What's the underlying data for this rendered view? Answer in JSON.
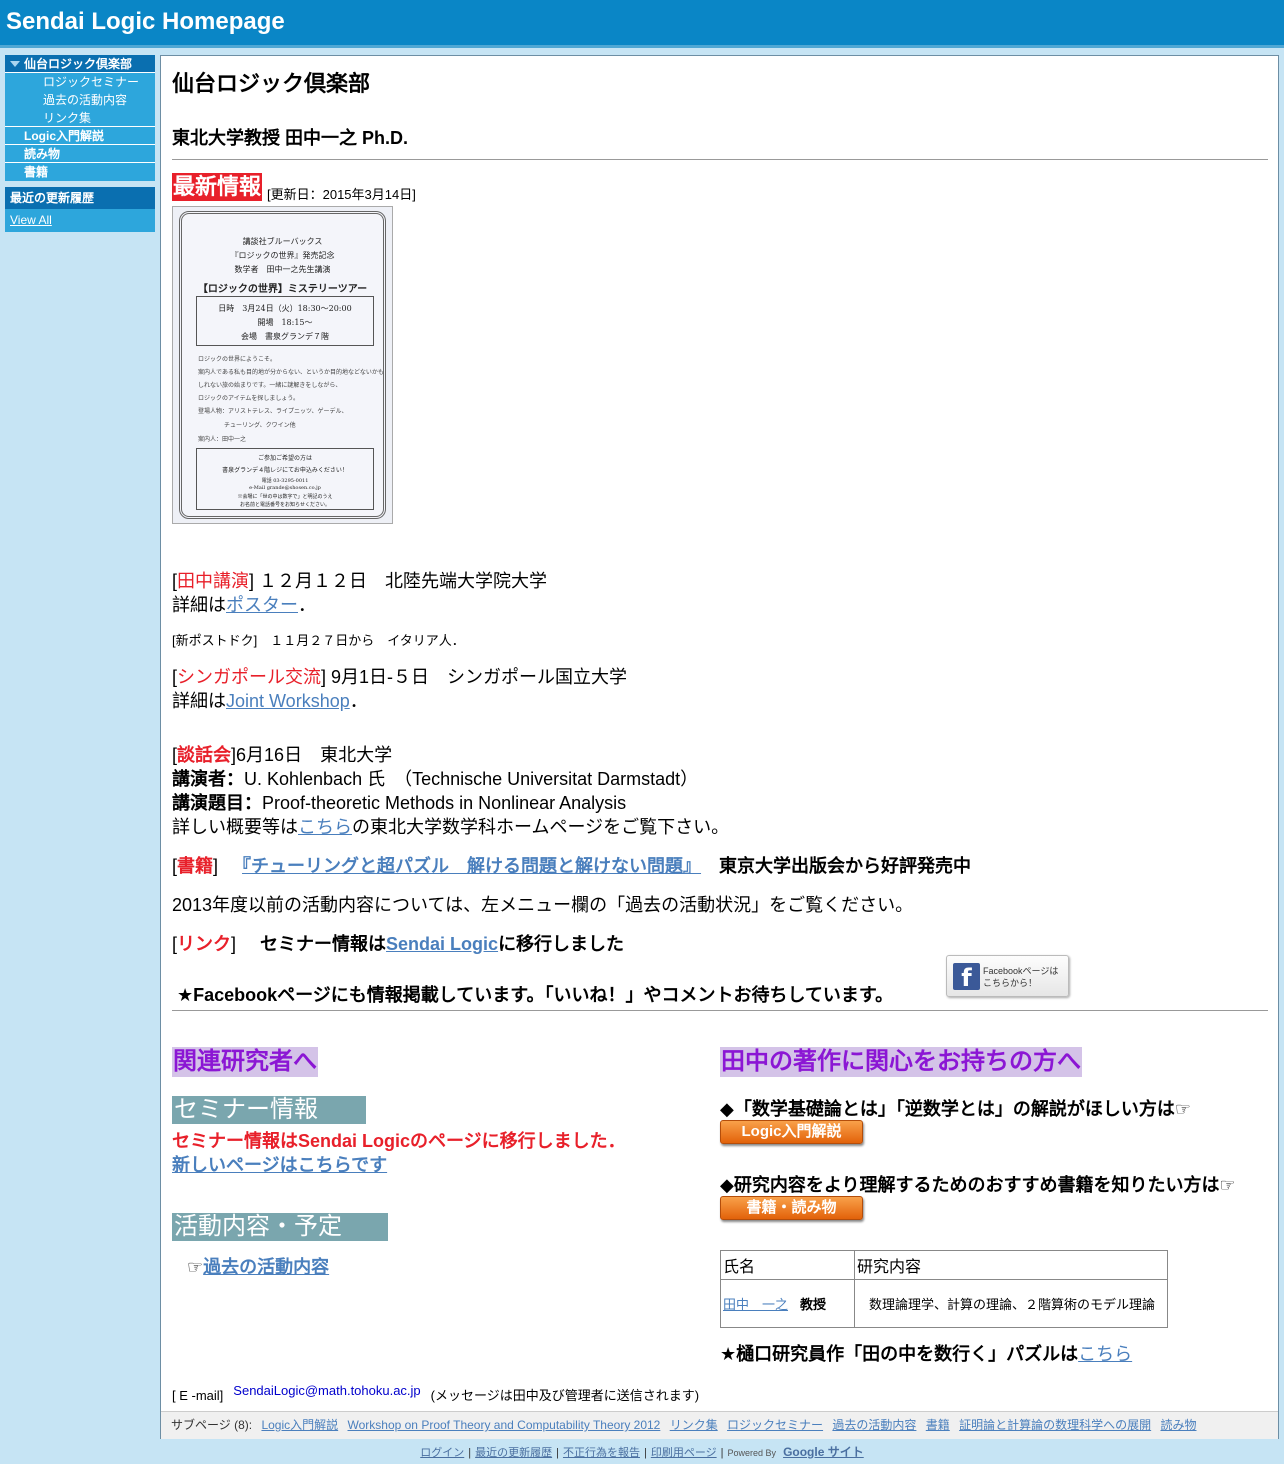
{
  "header": {
    "site_title": "Sendai Logic Homepage"
  },
  "sidebar": {
    "items": [
      {
        "label": "仙台ロジック倶楽部"
      },
      {
        "label": "ロジックセミナー"
      },
      {
        "label": "過去の活動内容"
      },
      {
        "label": "リンク集"
      },
      {
        "label": "Logic入門解説"
      },
      {
        "label": "読み物"
      },
      {
        "label": "書籍"
      }
    ],
    "recent_title": "最近の更新履歴",
    "recent_link": "View All"
  },
  "main": {
    "title": "仙台ロジック倶楽部",
    "subtitle": "東北大学教授 田中一之 Ph.D.",
    "news_title": "最新情報",
    "news_date": "[更新日：2015年3月14日]",
    "poster": {
      "l1": "講談社ブルーバックス",
      "l2": "『ロジックの世界』発売記念",
      "l3": "数学者　田中一之先生講演",
      "l4": "【ロジックの世界】ミステリーツアー",
      "l5": "日時　3月24日（火）18:30〜20:00",
      "l6": "開場　18:15〜",
      "l7": "会場　書泉グランデ７階",
      "s1": "ロジックの世界にようこそ。",
      "s2": "案内人である私も目的地が分からない、というか目的地などないかも",
      "s3": "しれない旅の始まりです。一緒に謎解きをしながら、",
      "s4": "ロジックのアイテムを探しましょう。",
      "s5": "登場人物：アリストテレス、ライプニッツ、ゲーデル、",
      "s6": "チューリング、クワイン他",
      "s7": "案内人：田中一之",
      "b1": "ご参加ご希望の方は",
      "b2": "書泉グランデ４階レジにてお申込みください！",
      "b3": "電話 03-3295-0011",
      "b4": "e-Mail  grande@shosen.co.jp",
      "b5": "※会場に「世の中は数字で」と明記のうえ",
      "b6": "お名前と電話番号をお知らせください。"
    },
    "lecture": {
      "tag": "田中講演",
      "text": " １２月１２日　北陸先端大学院大学",
      "detail_prefix": "詳細は",
      "detail_link": "ポスター",
      "detail_suffix": "．"
    },
    "postdoc": "[新ポストドク]　１１月２７日から　イタリア人．",
    "singapore": {
      "tag": "シンガポール交流",
      "text": " 9月1日-５日　シンガポール国立大学",
      "detail_prefix": "詳細は",
      "detail_link": "Joint Workshop",
      "detail_suffix": "．"
    },
    "colloquium": {
      "tag": "談話会",
      "text": "6月16日　東北大学",
      "speaker_label": "講演者：",
      "speaker": "U. Kohlenbach 氏　（Technische Universitat Darmstadt）",
      "topic_label": "講演題目：",
      "topic": "Proof-theoretic Methods in Nonlinear Analysis",
      "details_prefix": "詳しい概要等は",
      "details_link": "こちら",
      "details_suffix": "の東北大学数学科ホームページをご覧下さい。"
    },
    "book": {
      "tag": "書籍",
      "link": "『チューリングと超パズル　解ける問題と解けない問題』",
      "text": "東京大学出版会から好評発売中"
    },
    "past_note": "2013年度以前の活動内容については、左メニュー欄の「過去の活動状況」をご覧ください。",
    "link_line": {
      "tag": "リンク",
      "prefix": "セミナー情報は",
      "link": "Sendai Logic",
      "suffix": "に移行しました"
    },
    "facebook_line": "★Facebookページにも情報掲載しています。「いいね！」やコメントお待ちしています。",
    "facebook_btn": {
      "logo": "f",
      "line1": "Facebookページは",
      "line2": "こちらから！"
    },
    "left": {
      "heading": "関連研究者へ",
      "seminar_heading": "セミナー情報",
      "seminar_moved": "セミナー情報はSendai Logicのページに移行しました．",
      "seminar_link": "新しいページはこちらです",
      "activity_heading": "活動内容・予定",
      "activity_pointer": "☞",
      "activity_link": "過去の活動内容"
    },
    "right": {
      "heading": "田中の著作に関心をお持ちの方へ",
      "q1": "◆「数学基礎論とは」「逆数学とは」の解説がほしい方は☞",
      "btn1": "Logic入門解説",
      "q2": "◆研究内容をより理解するためのおすすめ書籍を知りたい方は☞",
      "btn2": "書籍・読み物",
      "table_headers": [
        "氏名",
        "研究内容"
      ],
      "table_name": "田中　一之",
      "table_title": "教授",
      "table_research": "数理論理学、計算の理論、２階算術のモデル理論",
      "puzzle_prefix": "★樋口研究員作「田の中を数行く」パズルは",
      "puzzle_link": "こちら"
    },
    "email_label": "[ E -mail]",
    "email": "SendaiLogic@math.tohoku.ac.jp",
    "email_note": "(メッセージは田中及び管理者に送信されます)",
    "subpages_label": "サブページ (8):",
    "subpages": [
      "Logic入門解説",
      "Workshop on Proof Theory and Computability Theory 2012",
      "リンク集",
      "ロジックセミナー",
      "過去の活動内容",
      "書籍",
      "証明論と計算論の数理科学への展開",
      "読み物"
    ]
  },
  "footer": {
    "links": [
      "ログイン",
      "最近の更新履歴",
      "不正行為を報告",
      "印刷用ページ"
    ],
    "powered": "Powered By",
    "google": "Google サイト"
  },
  "colors": {
    "header": "#0a86c6",
    "sidebar": "#2da6dc",
    "accent_red": "#e8202a",
    "purple": "#8b16d4",
    "teal": "#7aa6ae"
  }
}
